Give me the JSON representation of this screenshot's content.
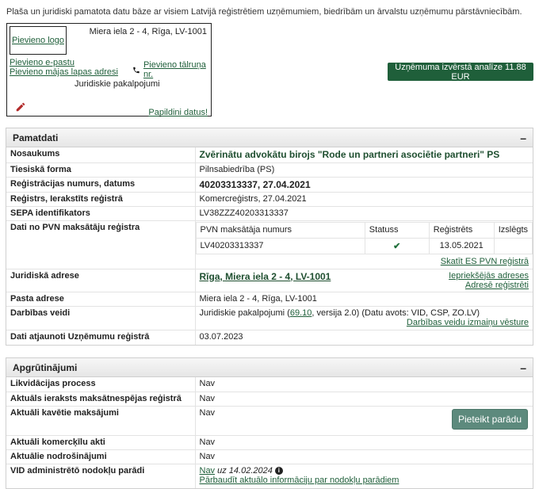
{
  "intro": "Plaša un juridiski pamatota datu bāze ar visiem Latvijā reģistrētiem uzņēmumiem, biedrībām un ārvalstu uzņēmumu pārstāvniecībām.",
  "card": {
    "add_logo": "Pievieno logo",
    "address": "Miera iela 2 - 4, Rīga, LV-1001",
    "add_email": "Pievieno e-pastu",
    "add_web": "Pievieno mājas lapas adresi",
    "add_phone": "Pievieno tālruņa nr.",
    "services": "Juridiskie pakalpojumi",
    "complete": "Papildini datus!"
  },
  "analysis_button": "Uzņēmuma izvērstā analīze 11.88 EUR",
  "pamatdati": {
    "title": "Pamatdati",
    "toggle": "–",
    "name_label": "Nosaukums",
    "name_value": "Zvērinātu advokātu birojs \"Rode un partneri asociētie partneri\" PS",
    "form_label": "Tiesiskā forma",
    "form_value": "Pilnsabiedrība (PS)",
    "reg_label": "Reģistrācijas numurs, datums",
    "reg_value": "40203313337, 27.04.2021",
    "registry_label": "Reģistrs, Ierakstīts reģistrā",
    "registry_value": "Komercreģistrs, 27.04.2021",
    "sepa_label": "SEPA identifikators",
    "sepa_value": "LV38ZZZ40203313337",
    "pvn_label": "Dati no PVN maksātāju reģistra",
    "pvn_headers": [
      "PVN maksātāja numurs",
      "Statuss",
      "Reģistrēts",
      "Izslēgts"
    ],
    "pvn_row": {
      "number": "LV40203313337",
      "status": "✔",
      "registered": "13.05.2021",
      "excluded": ""
    },
    "pvn_link": "Skatīt ES PVN reģistrā",
    "addr_label": "Juridiskā adrese",
    "addr_value": "Rīga, Miera iela 2 - 4, LV-1001",
    "addr_prev": "Iepriekšējās adreses",
    "addr_reg": "Adresē reģistrēti",
    "post_label": "Pasta adrese",
    "post_value": "Miera iela 2 - 4, Rīga, LV-1001",
    "activity_label": "Darbības veidi",
    "activity_pre": "Juridiskie pakalpojumi (",
    "activity_code": "69.10",
    "activity_post": ", versija 2.0) (Datu avots: VID, CSP, ZO.LV)",
    "activity_history": "Darbības veidu izmaiņu vēsture",
    "updated_label": "Dati atjaunoti Uzņēmumu reģistrā",
    "updated_value": "03.07.2023"
  },
  "apgrutinajumi": {
    "title": "Apgrūtinājumi",
    "toggle": "–",
    "liq_label": "Likvidācijas process",
    "liq_value": "Nav",
    "insolv_label": "Aktuāls ieraksts maksātnespējas reģistrā",
    "insolv_value": "Nav",
    "late_label": "Aktuāli kavētie maksājumi",
    "late_value": "Nav",
    "report_debt": "Pieteikt parādu",
    "pledge_label": "Aktuāli komercķīlu akti",
    "pledge_value": "Nav",
    "secure_label": "Aktuālie nodrošinājumi",
    "secure_value": "Nav",
    "vid_label": "VID administrētō nodokļu parādi",
    "vid_value": "Nav",
    "vid_date": " uz 14.02.2024 ",
    "vid_info": "i",
    "vid_check": "Pārbaudīt aktuālo informāciju par nodokļu parādiem"
  }
}
